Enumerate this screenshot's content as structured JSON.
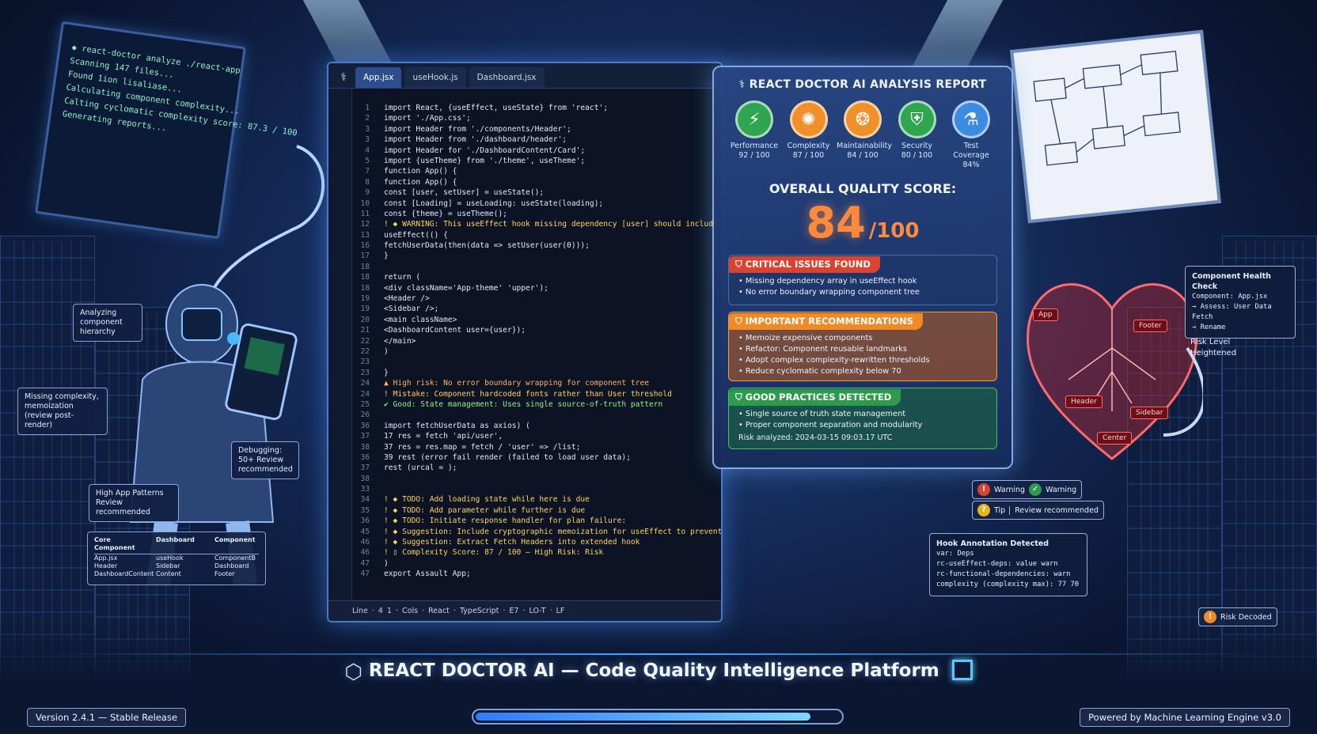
{
  "wall_monitor": {
    "lines": [
      "◆ react-doctor analyze ./react-app",
      "Scanning 147 files...",
      "Found 1ion lisaliase...",
      "Calculating component complexity...",
      "Calting cyclomatic complexity score: 87.3 / 100",
      "Generating reports..."
    ]
  },
  "callouts": {
    "analyzing": "Analyzing component hierarchy",
    "missing": "Missing complexity, memoization (review post-render)",
    "debugging": "Debugging: 50+ Review recommended",
    "high_app": "High App Patterns Review recommended"
  },
  "doc_table": {
    "headers": [
      "Core Component",
      "Dashboard",
      "Component"
    ],
    "rows": [
      [
        "App.jsx",
        "useHook",
        "ComponentB"
      ],
      [
        "Header",
        "Sidebar",
        "Dashboard"
      ],
      [
        "DashboardContent",
        "Content",
        "Footer"
      ]
    ]
  },
  "ide": {
    "tabs": [
      "App.jsx",
      "useHook.js",
      "Dashboard.jsx"
    ],
    "lines": [
      {
        "n": "1",
        "t": "import React, {useEffect, useState} from 'react';",
        "k": ""
      },
      {
        "n": "2",
        "t": "import './App.css';",
        "k": ""
      },
      {
        "n": "3",
        "t": "import Header from './components/Header';",
        "k": ""
      },
      {
        "n": "3",
        "t": "import Header from './dashboard/header';",
        "k": ""
      },
      {
        "n": "4",
        "t": "import Header for './DashboardContent/Card';",
        "k": ""
      },
      {
        "n": "5",
        "t": "import {useTheme} from './theme', useTheme';",
        "k": ""
      },
      {
        "n": "7",
        "t": "function App() {",
        "k": ""
      },
      {
        "n": "8",
        "t": "function App() {",
        "k": ""
      },
      {
        "n": "9",
        "t": "  const [user, setUser] = useState();",
        "k": ""
      },
      {
        "n": "10",
        "t": "  const [Loading] = useLoading: useState(loading);",
        "k": ""
      },
      {
        "n": "11",
        "t": "  const {theme} = useTheme();",
        "k": ""
      },
      {
        "n": "12",
        "t": "  ! ◆ WARNING: This useEffect hook missing dependency [user] should include",
        "k": "warn"
      },
      {
        "n": "13",
        "t": "      useEffect(() {",
        "k": ""
      },
      {
        "n": "16",
        "t": "        fetchUserData(then(data => setUser(user(0)));",
        "k": ""
      },
      {
        "n": "17",
        "t": "      }",
        "k": ""
      },
      {
        "n": "18",
        "t": "",
        "k": ""
      },
      {
        "n": "18",
        "t": "  return (",
        "k": ""
      },
      {
        "n": "18",
        "t": "        <div className='App-theme' 'upper');",
        "k": ""
      },
      {
        "n": "19",
        "t": "          <Header />",
        "k": ""
      },
      {
        "n": "19",
        "t": "          <Sidebar />;",
        "k": ""
      },
      {
        "n": "20",
        "t": "            <main className>",
        "k": ""
      },
      {
        "n": "21",
        "t": "              <DashboardContent user={user});",
        "k": ""
      },
      {
        "n": "22",
        "t": "              </main>",
        "k": ""
      },
      {
        "n": "22",
        "t": "        )",
        "k": ""
      },
      {
        "n": "23",
        "t": "",
        "k": ""
      },
      {
        "n": "23",
        "t": "      }",
        "k": ""
      },
      {
        "n": "24",
        "t": "  ▲ High risk: No error boundary wrapping for component tree",
        "k": "tag"
      },
      {
        "n": "24",
        "t": "  ! Mistake: Component hardcoded fonts rather than User threshold",
        "k": "warn"
      },
      {
        "n": "25",
        "t": "  ✔ Good: State management: Uses single source-of-truth pattern",
        "k": "ok"
      },
      {
        "n": "26",
        "t": "",
        "k": ""
      },
      {
        "n": "36",
        "t": " import fetchUserData as axios) (",
        "k": ""
      },
      {
        "n": "37",
        "t": "    17  res = fetch 'api/user',",
        "k": ""
      },
      {
        "n": "38",
        "t": "    37  res = res.map = fetch / 'user' => /list;",
        "k": ""
      },
      {
        "n": "36",
        "t": "    39  rest (error fail render (failed to load user data);",
        "k": ""
      },
      {
        "n": "37",
        "t": "        rest (urcal = );",
        "k": ""
      },
      {
        "n": "38",
        "t": "",
        "k": ""
      },
      {
        "n": "33",
        "t": "",
        "k": ""
      },
      {
        "n": "34",
        "t": "  ! ◆ TODO: Add loading state while here is due",
        "k": "warn"
      },
      {
        "n": "35",
        "t": "  ! ◆ TODO: Add parameter while further is due",
        "k": "warn"
      },
      {
        "n": "36",
        "t": "  ! ◆ TODO: Initiate response handler for plan failure:",
        "k": "warn"
      },
      {
        "n": "45",
        "t": "  ! ◆ Suggestion: Include cryptographic memoization for useEffect to prevent unnecessary renders",
        "k": "warn"
      },
      {
        "n": "46",
        "t": "  ! ◆ Suggestion: Extract Fetch Headers into extended hook",
        "k": "warn"
      },
      {
        "n": "46",
        "t": "  ! ▯ Complexity Score: 87 / 100 — High Risk: Risk",
        "k": "warn"
      },
      {
        "n": "47",
        "t": " )",
        "k": ""
      },
      {
        "n": "47",
        "t": "export Assault App;",
        "k": ""
      }
    ],
    "status": "Line · 4 1 · Cols · React · TypeScript · E7 · LO-T · LF"
  },
  "report": {
    "title": "REACT DOCTOR AI ANALYSIS REPORT",
    "metrics": [
      {
        "name": "Performance",
        "value": "92 / 100",
        "icon": "lightning-icon",
        "glyph": "⚡",
        "color": "#2fa552"
      },
      {
        "name": "Complexity",
        "value": "87 / 100",
        "icon": "brain-icon",
        "glyph": "✺",
        "color": "#f0902a"
      },
      {
        "name": "Maintainability",
        "value": "84 / 100",
        "icon": "brain-gear-icon",
        "glyph": "❂",
        "color": "#f0902a"
      },
      {
        "name": "Security",
        "value": "80 / 100",
        "icon": "shield-icon",
        "glyph": "⛨",
        "color": "#2fa552"
      },
      {
        "name": "Test Coverage",
        "value": "84%",
        "icon": "test-tube-icon",
        "glyph": "⚗",
        "color": "#3b8be0"
      }
    ],
    "score_label": "OVERALL QUALITY SCORE:",
    "score": "84",
    "score_max": "/100",
    "critical": {
      "title": "CRITICAL ISSUES FOUND",
      "items": [
        "Missing dependency array in useEffect hook",
        "No error boundary wrapping component tree"
      ]
    },
    "recommendations": {
      "title": "IMPORTANT RECOMMENDATIONS",
      "items": [
        "Memoize expensive components",
        "Refactor: Component reusable landmarks",
        "Adopt complex complexity-rewritten thresholds",
        "Reduce cyclomatic complexity below 70"
      ]
    },
    "good": {
      "title": "GOOD PRACTICES DETECTED",
      "items": [
        "Single source of truth state management",
        "Proper component separation and modularity"
      ],
      "timestamp": "Risk analyzed: 2024-03-15 09:03.17 UTC"
    }
  },
  "heart": {
    "tags": [
      "App",
      "Header",
      "Footer",
      "Sidebar",
      "Center"
    ],
    "health_check": {
      "title": "Component Health Check",
      "lines": [
        "Component: App.jsx",
        "→ Assess: User Data Fetch",
        "→ Rename"
      ]
    },
    "risk": "Risk Level Heightened"
  },
  "legend": {
    "warning": "Warning",
    "warn2": "Warning",
    "tip": "Tip",
    "review": "Review recommended"
  },
  "hook_panel": {
    "title": "Hook Annotation Detected",
    "lines": [
      "var: Deps",
      "rc-useEffect-deps: value   warn",
      "rc-functional-dependencies: warn",
      "complexity (complexity max): 77 70"
    ]
  },
  "risk_badge": "Risk Decoded",
  "footer": {
    "title": "REACT DOCTOR AI — Code Quality Intelligence Platform",
    "version": "Version 2.4.1 — Stable Release",
    "powered": "Powered by Machine Learning Engine v3.0",
    "progress": 0.92
  }
}
